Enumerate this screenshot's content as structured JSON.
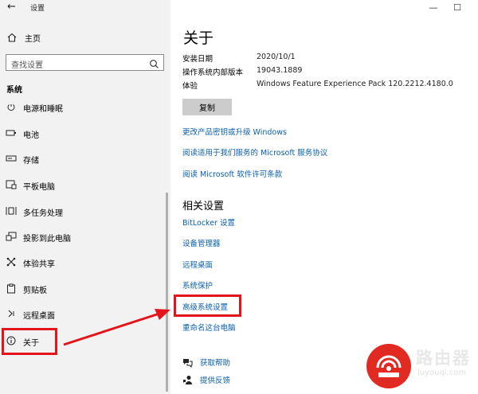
{
  "window": {
    "title": "设置",
    "back_glyph": "←",
    "min_glyph": "—",
    "max_glyph": "☐"
  },
  "sidebar": {
    "home": {
      "label": "主页",
      "icon": "home-icon"
    },
    "search": {
      "placeholder": "查找设置",
      "icon": "search-icon"
    },
    "section": "系统",
    "items": [
      {
        "label": "电源和睡眠",
        "icon": "power-icon"
      },
      {
        "label": "电池",
        "icon": "battery-icon"
      },
      {
        "label": "存储",
        "icon": "storage-icon"
      },
      {
        "label": "平板电脑",
        "icon": "tablet-icon"
      },
      {
        "label": "多任务处理",
        "icon": "multitasking-icon"
      },
      {
        "label": "投影到此电脑",
        "icon": "projecting-icon"
      },
      {
        "label": "体验共享",
        "icon": "shared-experiences-icon"
      },
      {
        "label": "剪贴板",
        "icon": "clipboard-icon"
      },
      {
        "label": "远程桌面",
        "icon": "remote-desktop-icon"
      },
      {
        "label": "关于",
        "icon": "info-icon",
        "selected": true
      }
    ]
  },
  "main": {
    "title": "关于",
    "specs": [
      {
        "key": "安装日期",
        "value": "2020/10/1"
      },
      {
        "key": "操作系统内部版本",
        "value": "19043.1889"
      },
      {
        "key": "体验",
        "value": "Windows Feature Experience Pack 120.2212.4180.0"
      }
    ],
    "copy_button": "复制",
    "links": [
      "更改产品密钥或升级 Windows",
      "阅读适用于我们服务的 Microsoft 服务协议",
      "阅读 Microsoft 软件许可条款"
    ],
    "related_title": "相关设置",
    "related_links": [
      "BitLocker 设置",
      "设备管理器",
      "远程桌面",
      "系统保护",
      "高级系统设置",
      "重命名这台电脑"
    ],
    "help": [
      {
        "label": "获取帮助",
        "icon": "help-chat-icon"
      },
      {
        "label": "提供反馈",
        "icon": "feedback-icon"
      }
    ]
  },
  "watermark": {
    "text": "路由器",
    "url": "luyouqi.com"
  },
  "colors": {
    "link": "#0a5fae",
    "highlight": "#e3141b",
    "sidebar_bg": "#f2f2f2",
    "button_bg": "#cccccc"
  }
}
